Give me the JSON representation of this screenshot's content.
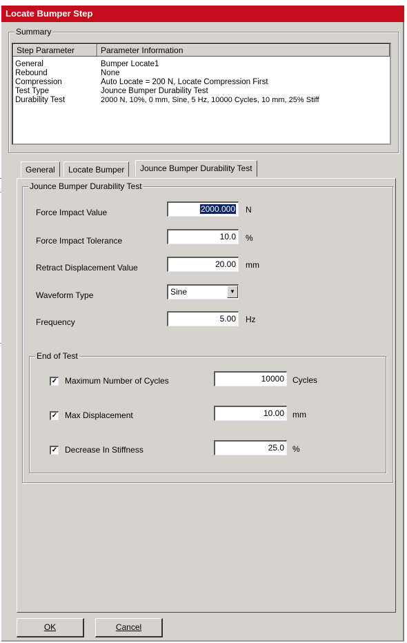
{
  "window": {
    "title": "Locate Bumper Step"
  },
  "summary": {
    "title": "Summary",
    "columns": [
      "Step Parameter",
      "Parameter Information"
    ],
    "rows": [
      {
        "param": "General",
        "info": "Bumper Locate1"
      },
      {
        "param": "Rebound",
        "info": "None"
      },
      {
        "param": "Compression",
        "info": "Auto Locate = 200 N,  Locate Compression First"
      },
      {
        "param": "Test Type",
        "info": "Jounce Bumper Durability Test"
      },
      {
        "param": "Durability Test",
        "info": "2000 N, 10%, 0 mm, Sine, 5 Hz, 10000 Cycles, 10 mm, 25% Stiff"
      }
    ]
  },
  "tabs": {
    "general": "General",
    "locate_bumper": "Locate Bumper",
    "jounce": "Jounce Bumper Durability Test"
  },
  "jounce": {
    "group_title": "Jounce Bumper Durability Test",
    "force_impact_label": "Force Impact Value",
    "force_impact_value": "2000.000",
    "force_impact_unit": "N",
    "force_tol_label": "Force Impact Tolerance",
    "force_tol_value": "10.0",
    "force_tol_unit": "%",
    "retract_label": "Retract Displacement Value",
    "retract_value": "20.00",
    "retract_unit": "mm",
    "waveform_label": "Waveform Type",
    "waveform_value": "Sine",
    "frequency_label": "Frequency",
    "frequency_value": "5.00",
    "frequency_unit": "Hz"
  },
  "end_of_test": {
    "title": "End of Test",
    "max_cycles_label": "Maximum Number of Cycles",
    "max_cycles_value": "10000",
    "max_cycles_unit": "Cycles",
    "max_disp_label": "Max Displacement",
    "max_disp_value": "10.00",
    "max_disp_unit": "mm",
    "stiffness_label": "Decrease In Stiffness",
    "stiffness_value": "25.0",
    "stiffness_unit": "%",
    "checked": [
      true,
      true,
      true
    ]
  },
  "buttons": {
    "ok": "OK",
    "cancel": "Cancel"
  },
  "icons": {
    "checkmark": "check-icon",
    "dropdown": "chevron-down-icon"
  },
  "colors": {
    "title_bar": "#c30d1c",
    "selection": "#0a246a",
    "dialog_bg": "#d6d3ce"
  }
}
